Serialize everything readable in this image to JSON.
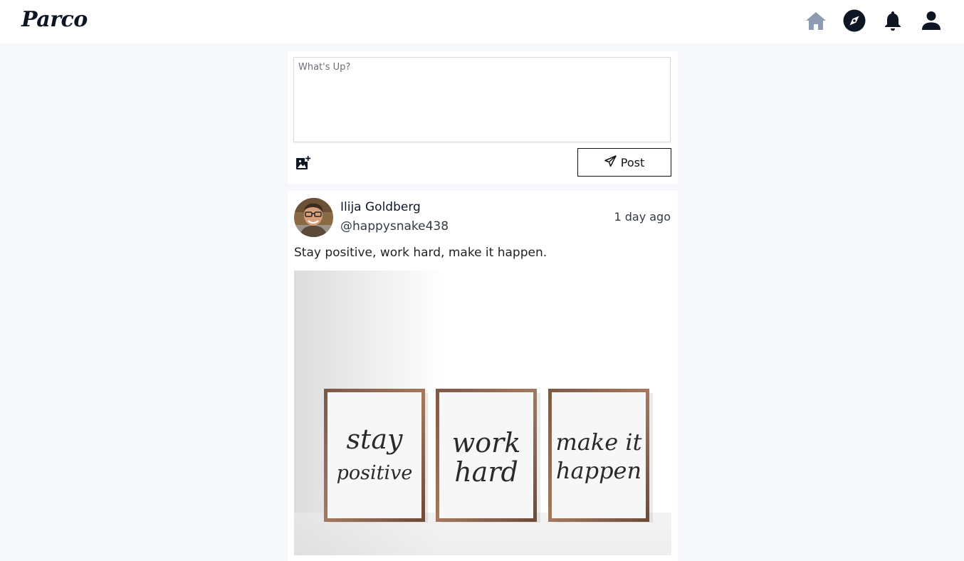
{
  "app": {
    "logo_text": "Parco"
  },
  "nav": {
    "items": [
      {
        "name": "home",
        "icon": "home-icon",
        "active": true,
        "color": "#8e9bb5"
      },
      {
        "name": "explore",
        "icon": "compass-icon",
        "active": false,
        "color": "#0f1623"
      },
      {
        "name": "notifications",
        "icon": "bell-icon",
        "active": false,
        "color": "#0f1623"
      },
      {
        "name": "profile",
        "icon": "user-icon",
        "active": false,
        "color": "#0f1623"
      }
    ]
  },
  "composer": {
    "placeholder": "What's Up?",
    "value": "",
    "add_image_icon": "add-image-icon",
    "post_label": "Post",
    "post_icon": "paper-plane-icon"
  },
  "post": {
    "author_name": "Ilija Goldberg",
    "author_handle": "@happysnake438",
    "time": "1 day ago",
    "text": "Stay positive, work hard, make it happen.",
    "image": {
      "frames": [
        {
          "line1": "stay",
          "line2": "positive"
        },
        {
          "line1": "work",
          "line2": "hard"
        },
        {
          "line1": "make it",
          "line2": "happen"
        }
      ]
    }
  }
}
